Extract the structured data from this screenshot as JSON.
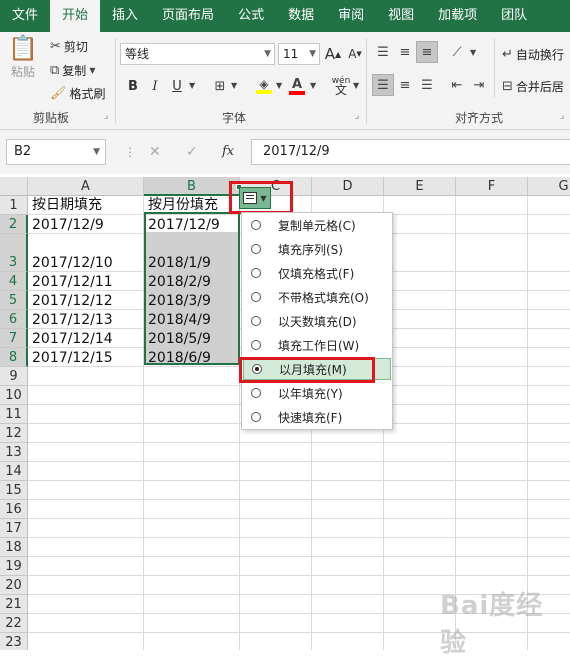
{
  "menubar": {
    "tabs": [
      "文件",
      "开始",
      "插入",
      "页面布局",
      "公式",
      "数据",
      "审阅",
      "视图",
      "加载项",
      "团队"
    ],
    "active_tab": "开始",
    "accent_color": "#217346"
  },
  "ribbon": {
    "clipboard": {
      "paste_label": "粘贴",
      "cut_label": "剪切",
      "copy_label": "复制",
      "format_painter_label": "格式刷",
      "group_label": "剪贴板"
    },
    "font": {
      "font_name": "等线",
      "font_size": "11",
      "group_label": "字体",
      "bold": "B",
      "italic": "I",
      "underline": "U",
      "grow_font": "A",
      "shrink_font": "A",
      "fill_color": "#ffff00",
      "font_color": "#ff0000",
      "phonetic": "wén"
    },
    "alignment": {
      "wrap_text_label": "自动换行",
      "merge_label": "合并后居",
      "group_label": "对齐方式"
    }
  },
  "formula_bar": {
    "name_box": "B2",
    "cancel": "✕",
    "enter": "✓",
    "fx": "fx",
    "value": "2017/12/9"
  },
  "sheet": {
    "columns": [
      "A",
      "B",
      "C",
      "D",
      "E",
      "F",
      "G"
    ],
    "selected_column": "B",
    "rows": [
      "1",
      "2",
      "3",
      "4",
      "5",
      "6",
      "7",
      "8",
      "9",
      "10",
      "11",
      "12",
      "13",
      "14",
      "15",
      "16",
      "17",
      "18",
      "19",
      "20",
      "21",
      "22",
      "23"
    ],
    "selected_rows": [
      "2",
      "3",
      "4",
      "5",
      "6",
      "7",
      "8"
    ],
    "col_a": [
      "按日期填充",
      "2017/12/9",
      "2017/12/10",
      "2017/12/11",
      "2017/12/12",
      "2017/12/13",
      "2017/12/14",
      "2017/12/15"
    ],
    "col_b": [
      "按月份填充",
      "2017/12/9",
      "2018/1/9",
      "2018/2/9",
      "2018/3/9",
      "2018/4/9",
      "2018/5/9",
      "2018/6/9"
    ]
  },
  "autofill_menu": {
    "items": [
      {
        "label": "复制单元格(C)",
        "checked": false
      },
      {
        "label": "填充序列(S)",
        "checked": false
      },
      {
        "label": "仅填充格式(F)",
        "checked": false
      },
      {
        "label": "不带格式填充(O)",
        "checked": false
      },
      {
        "label": "以天数填充(D)",
        "checked": false
      },
      {
        "label": "填充工作日(W)",
        "checked": false
      },
      {
        "label": "以月填充(M)",
        "checked": true
      },
      {
        "label": "以年填充(Y)",
        "checked": false
      },
      {
        "label": "快速填充(F)",
        "checked": false
      }
    ],
    "highlight_color": "#e0161d"
  },
  "watermark": "Bai度经验"
}
